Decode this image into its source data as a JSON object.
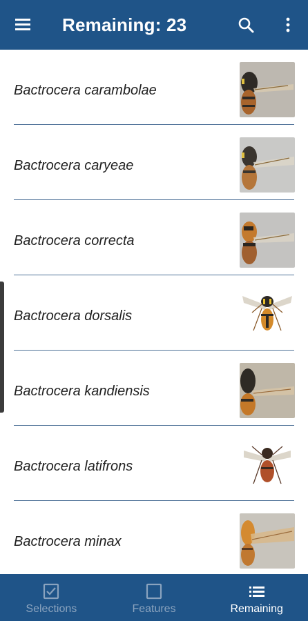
{
  "app_bar": {
    "title": "Remaining: 23",
    "menu_icon": "hamburger-menu-icon",
    "search_icon": "search-icon",
    "more_icon": "more-vertical-icon",
    "background": "#1f5488"
  },
  "species": [
    {
      "name": "Bactrocera carambolae",
      "image": "fly-side-view"
    },
    {
      "name": "Bactrocera caryeae",
      "image": "fly-side-view"
    },
    {
      "name": "Bactrocera correcta",
      "image": "fly-side-view"
    },
    {
      "name": "Bactrocera dorsalis",
      "image": "fly-dorsal-view"
    },
    {
      "name": "Bactrocera kandiensis",
      "image": "fly-side-view"
    },
    {
      "name": "Bactrocera latifrons",
      "image": "fly-dorsal-view"
    },
    {
      "name": "Bactrocera minax",
      "image": "fly-side-view"
    }
  ],
  "bottom_nav": {
    "items": [
      {
        "label": "Selections",
        "icon": "checkbox-checked-icon",
        "active": false
      },
      {
        "label": "Features",
        "icon": "checkbox-empty-icon",
        "active": false
      },
      {
        "label": "Remaining",
        "icon": "list-icon",
        "active": true
      }
    ],
    "active_color": "#ffffff",
    "inactive_color": "#8aa3be"
  }
}
